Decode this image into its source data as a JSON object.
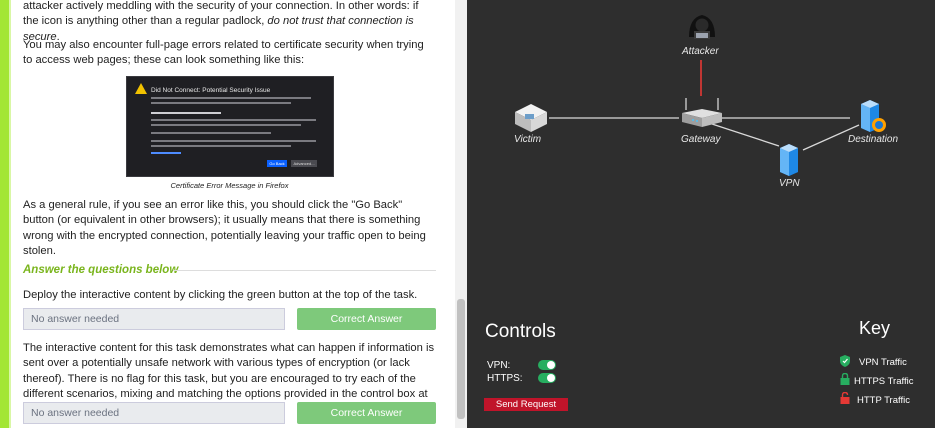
{
  "article": {
    "intro_text": "attacker actively meddling with the security of your connection. In other words: if the icon is anything other than a regular padlock, ",
    "intro_emphasis": "do not trust that connection is secure",
    "intro_end": ".",
    "full_page_errors": "You may also encounter full-page errors related to certificate security when trying to access web pages; these can look something like this:",
    "cert_image": {
      "title": "Did Not Connect: Potential Security Issue",
      "go_back_label": "Go Back",
      "advanced_label": "Advanced..."
    },
    "caption": "Certificate Error Message in Firefox",
    "general_rule": "As a general rule, if you see an error like this, you should click the \"Go Back\" button (or equivalent in other browsers); it usually means that there is something wrong with the encrypted connection, potentially leaving your traffic open to being stolen."
  },
  "questions": {
    "header": "Answer the questions below",
    "q1_text": "Deploy the interactive content by clicking the green button at the top of the task.",
    "q1_answer": "No answer needed",
    "q1_button": "Correct Answer",
    "q2_text": "The interactive content for this task demonstrates what can happen if information is sent over a potentially unsafe network with various types of encryption (or lack thereof). There is no flag for this task, but you are encouraged to try each of the different scenarios, mixing and matching the options provided in the control box at the bottom right of the screen.",
    "q2_answer": "No answer needed",
    "q2_button": "Correct Answer"
  },
  "network": {
    "attacker_label": "Attacker",
    "victim_label": "Victim",
    "gateway_label": "Gateway",
    "destination_label": "Destination",
    "vpn_label": "VPN",
    "colors": {
      "attack_line": "#e53935",
      "link_line": "#d9d9d9",
      "background": "#2e2e2e"
    }
  },
  "controls": {
    "title": "Controls",
    "vpn_label": "VPN:",
    "vpn_on": true,
    "https_label": "HTTPS:",
    "https_on": true,
    "send_button": "Send Request"
  },
  "key": {
    "title": "Key",
    "vpn": "VPN Traffic",
    "https": "HTTPS Traffic",
    "http": "HTTP Traffic",
    "colors": {
      "vpn": "#27ae60",
      "https": "#27ae60",
      "http": "#e53935"
    },
    "icons": {
      "vpn": "shield-icon",
      "https": "lock-icon",
      "http": "unlock-icon"
    }
  }
}
